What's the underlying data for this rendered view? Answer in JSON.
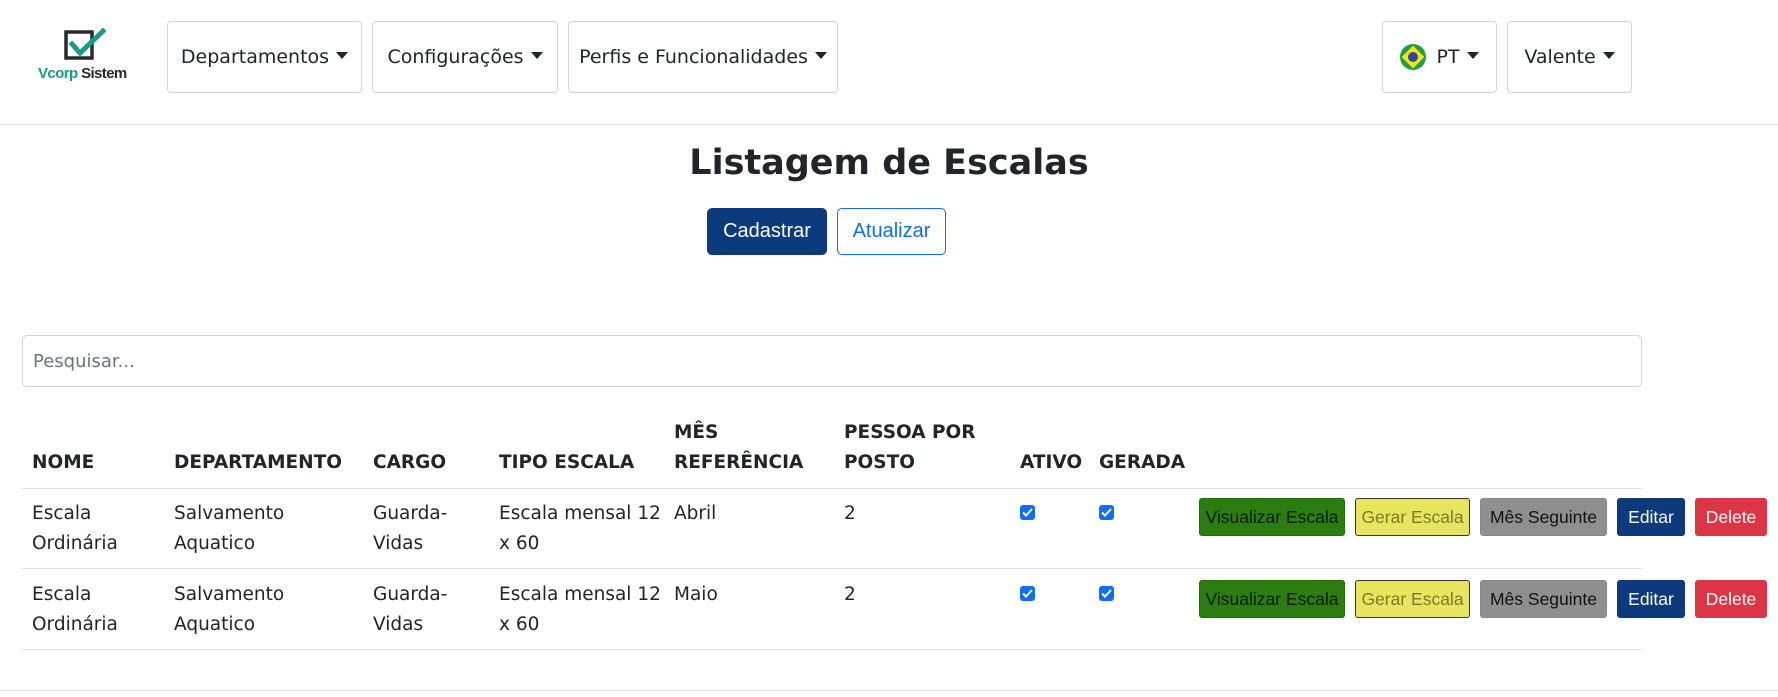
{
  "brand": {
    "name_a": "Vcorp",
    "name_b": " Sistem",
    "icon": "checkbox-check-icon"
  },
  "nav": {
    "menus": [
      "Departamentos",
      "Configurações",
      "Perfis e Funcionalidades"
    ],
    "language": "PT",
    "language_icon": "brazil-flag-icon",
    "user": "Valente"
  },
  "page": {
    "title": "Listagem de Escalas",
    "register_label": "Cadastrar",
    "refresh_label": "Atualizar"
  },
  "search": {
    "placeholder": "Pesquisar...",
    "value": ""
  },
  "table": {
    "headers": {
      "nome": "NOME",
      "departamento": "DEPARTAMENTO",
      "cargo": "CARGO",
      "tipo_escala": "TIPO ESCALA",
      "mes_referencia_1": "MÊS",
      "mes_referencia_2": "REFERÊNCIA",
      "pessoa_por_posto_1": "PESSOA POR",
      "pessoa_por_posto_2": "POSTO",
      "ativo": "ATIVO",
      "gerada": "GERADA"
    },
    "rows": [
      {
        "nome_1": "Escala",
        "nome_2": "Ordinária",
        "departamento_1": "Salvamento",
        "departamento_2": "Aquatico",
        "cargo_1": "Guarda-",
        "cargo_2": "Vidas",
        "tipo_1": "Escala mensal 12",
        "tipo_2": "x 60",
        "mes": "Abril",
        "pessoas": "2",
        "ativo": true,
        "gerada": true
      },
      {
        "nome_1": "Escala",
        "nome_2": "Ordinária",
        "departamento_1": "Salvamento",
        "departamento_2": "Aquatico",
        "cargo_1": "Guarda-",
        "cargo_2": "Vidas",
        "tipo_1": "Escala mensal 12",
        "tipo_2": "x 60",
        "mes": "Maio",
        "pessoas": "2",
        "ativo": true,
        "gerada": true
      }
    ],
    "actions": {
      "view": "Visualizar Escala",
      "generate": "Gerar Escala",
      "next_month": "Mês Seguinte",
      "edit": "Editar",
      "delete": "Delete"
    }
  },
  "colors": {
    "primary": "#0d3a7c",
    "outline": "#0d6efd",
    "view": "#2a7d0e",
    "generate": "#e6e55d",
    "next_month": "#8f8f8f",
    "delete": "#dc3545",
    "brand_teal": "#1a9a8a"
  }
}
